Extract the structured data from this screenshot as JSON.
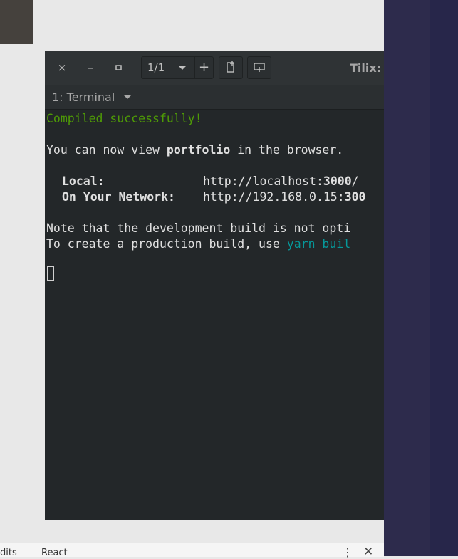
{
  "window": {
    "app_title": "Tilix: ",
    "session_selector": "1/1",
    "tab_label": "1: Terminal"
  },
  "toolbar": {
    "close": "×",
    "minimize": "–",
    "maximize": "▫",
    "add": "+"
  },
  "terminal": {
    "compiled": "Compiled successfully!",
    "view_prefix": "You can now view ",
    "app_name": "portfolio",
    "view_suffix": " in the browser.",
    "local_label": "Local:",
    "local_url_prefix": "http://localhost:",
    "local_port": "3000",
    "local_url_suffix": "/",
    "network_label": "On Your Network:",
    "network_url_prefix": "http://192.168.0.15:",
    "network_port_partial": "300",
    "note_line": "Note that the development build is not opti",
    "prod_prefix": "To create a production build, use ",
    "prod_cmd_partial": "yarn buil"
  },
  "bottom_bar": {
    "left_text": "dits",
    "second_text": "React",
    "kebab": "⋮",
    "close": "✕"
  }
}
